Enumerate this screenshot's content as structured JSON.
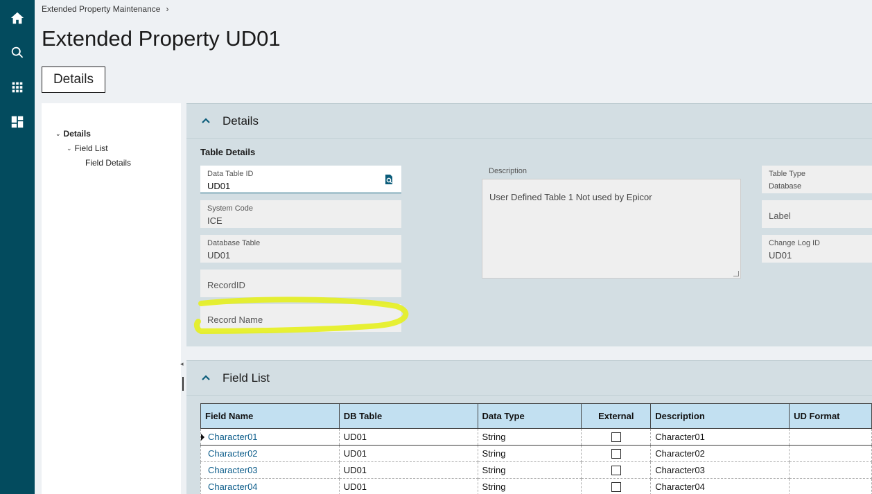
{
  "rail": {
    "icons": [
      "home-icon",
      "search-icon",
      "apps-grid-icon",
      "dashboard-icon"
    ]
  },
  "breadcrumb": {
    "item": "Extended Property Maintenance",
    "separator": "›"
  },
  "page": {
    "title": "Extended Property UD01",
    "tab": "Details"
  },
  "tree": {
    "items": [
      {
        "label": "Details"
      },
      {
        "label": "Field List"
      },
      {
        "label": "Field Details"
      }
    ]
  },
  "details_panel": {
    "title": "Details",
    "section": "Table Details",
    "data_table_id": {
      "label": "Data Table ID",
      "value": "UD01"
    },
    "system_code": {
      "label": "System Code",
      "value": "ICE"
    },
    "database_table": {
      "label": "Database Table",
      "value": "UD01"
    },
    "record_id": {
      "placeholder": "RecordID"
    },
    "record_name": {
      "placeholder": "Record Name"
    },
    "description": {
      "label": "Description",
      "value": "User Defined Table 1 Not used by Epicor"
    },
    "table_type": {
      "label": "Table Type",
      "value": "Database"
    },
    "label_field": {
      "placeholder": "Label"
    },
    "change_log_id": {
      "label": "Change Log ID",
      "value": "UD01"
    }
  },
  "field_list_panel": {
    "title": "Field List",
    "columns": [
      "Field Name",
      "DB Table",
      "Data Type",
      "External",
      "Description",
      "UD Format"
    ],
    "rows": [
      {
        "field_name": "Character01",
        "db_table": "UD01",
        "data_type": "String",
        "external": false,
        "description": "Character01",
        "ud_format": ""
      },
      {
        "field_name": "Character02",
        "db_table": "UD01",
        "data_type": "String",
        "external": false,
        "description": "Character02",
        "ud_format": ""
      },
      {
        "field_name": "Character03",
        "db_table": "UD01",
        "data_type": "String",
        "external": false,
        "description": "Character03",
        "ud_format": ""
      },
      {
        "field_name": "Character04",
        "db_table": "UD01",
        "data_type": "String",
        "external": false,
        "description": "Character04",
        "ud_format": ""
      }
    ]
  },
  "colors": {
    "rail": "#034b5e",
    "panel": "#d3dee3",
    "grid_header": "#c2e0f1",
    "link": "#0b5c8a",
    "highlight": "#e6f01e"
  }
}
